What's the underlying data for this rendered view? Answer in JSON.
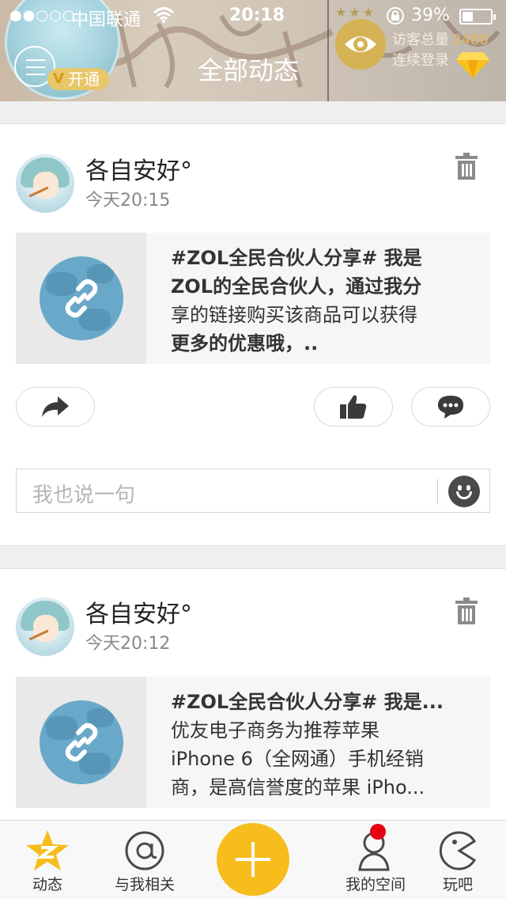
{
  "status_bar": {
    "signal": "●●○○○",
    "carrier": "中国联通",
    "time": "20:18",
    "battery_pct": "39%",
    "battery_level": 0.39
  },
  "header": {
    "title": "全部动态",
    "vip_label": "开通",
    "vip_badge": "V",
    "visitor_label": "访客总量",
    "visitor_count": "2480",
    "login_label": "连续登录",
    "stars": "★★★",
    "accent_color": "#f6bd1d"
  },
  "posts": [
    {
      "username": "各自安好°",
      "time": "今天20:15",
      "share_lines": [
        "#ZOL全民合伙人分享# 我是",
        "ZOL的全民合伙人，通过我分",
        "享的链接购买该商品可以获得",
        "更多的优惠哦，.."
      ]
    },
    {
      "username": "各自安好°",
      "time": "今天20:12",
      "share_lines": [
        "#ZOL全民合伙人分享# 我是...",
        "优友电子商务为推荐苹果",
        "iPhone 6（全网通）手机经销",
        "商，是高信誉度的苹果 iPho..."
      ]
    }
  ],
  "comment_input": {
    "placeholder": "我也说一句"
  },
  "tabbar": {
    "tabs": [
      {
        "label": "动态",
        "icon": "qzone-star-icon"
      },
      {
        "label": "与我相关",
        "icon": "at-icon"
      },
      {
        "label": "",
        "icon": "plus-icon"
      },
      {
        "label": "我的空间",
        "icon": "person-icon"
      },
      {
        "label": "玩吧",
        "icon": "pacman-icon"
      }
    ]
  }
}
